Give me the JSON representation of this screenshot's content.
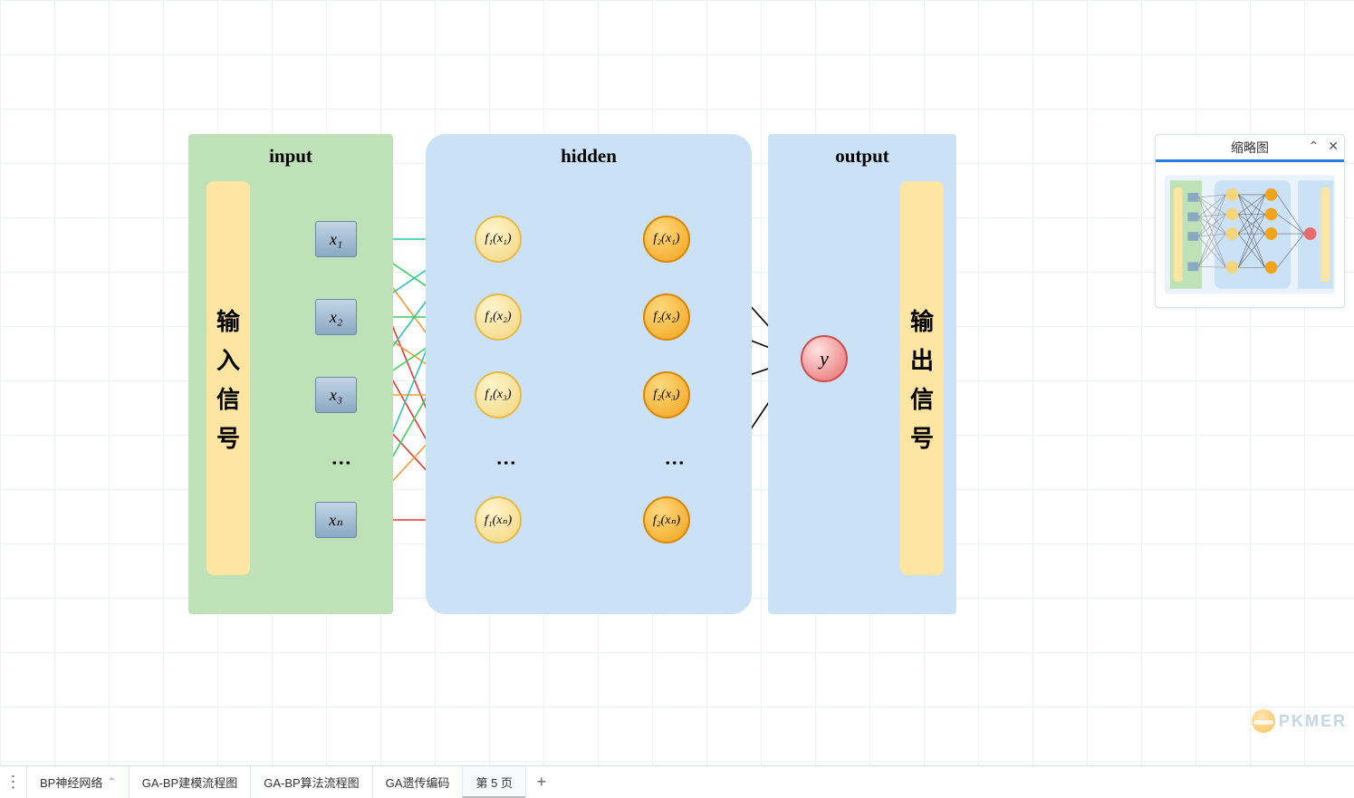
{
  "layers": {
    "input_title": "input",
    "hidden_title": "hidden",
    "output_title": "output"
  },
  "signals": {
    "input_c": [
      "输",
      "入",
      "信",
      "号"
    ],
    "output_c": [
      "输",
      "出",
      "信",
      "号"
    ]
  },
  "inputs": [
    "x₁",
    "x₂",
    "x₃",
    "xₙ"
  ],
  "hidden1": [
    "f₁(x₁)",
    "f₁(x₂)",
    "f₁(x₃)",
    "f₁(xₙ)"
  ],
  "hidden2": [
    "f₂(x₁)",
    "f₂(x₂)",
    "f₂(x₃)",
    "f₂(xₙ)"
  ],
  "output_node": "y",
  "vdots": "⋮",
  "minimap": {
    "title": "缩略图"
  },
  "tabs": {
    "items": [
      {
        "label": "BP神经网络",
        "chev": true
      },
      {
        "label": "GA-BP建模流程图"
      },
      {
        "label": "GA-BP算法流程图"
      },
      {
        "label": "GA遗传编码"
      },
      {
        "label": "第 5 页",
        "active": true
      }
    ]
  },
  "watermark": "PKMER",
  "arrow_colors": {
    "c0": "#2fc6b3",
    "c1": "#3ad15e",
    "c2": "#f29d35",
    "c3": "#e53935",
    "black": "#000"
  }
}
